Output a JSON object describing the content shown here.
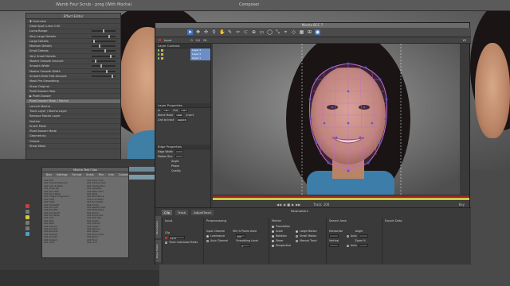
{
  "topbar": {
    "title": "Composer",
    "sequence": "Wamb Four Scrub - prog (With Mocha)"
  },
  "effect_editor": {
    "title": "Effect Editor",
    "rows": [
      "▼ Overview",
      "Glow  Spot Luma  0.00",
      "Luma Range",
      "Very Large Details",
      "Large Details",
      "Medium Details",
      "Small Details",
      "Very Small Details",
      "Master Smooth Amount",
      "Smooth Width",
      "Master Smooth Width",
      "Smooth Rate Edit Amount",
      "Mask Pre-Smoothing",
      "Show Original",
      "PixelChooser Help",
      "▶ PixelChooser",
      "PixelChooser Mask / Mocha",
      "Launch Mocha",
      "Track Layer / Mocha Layer",
      "Remove Mocha Layer",
      "Feather",
      "Invert Mask",
      "PixelChooser Mode",
      "Geometrics",
      "Output",
      "Show Mask"
    ]
  },
  "bin": {
    "title": "Mocha Test Clips",
    "tabs": [
      "Bins",
      "Settings",
      "Format",
      "Script",
      "Film",
      "Info",
      "Custom"
    ],
    "left_clips": [
      "A01 Skin",
      "A01 Frame Enhanced",
      "A01 Cam & Wide",
      "A01 Close Up",
      "A01 Face Mid",
      "A01 Face Wide",
      "A01 Fridge Foreground",
      "A01 Flare",
      "A01 Flash",
      "A01 Highlight",
      "A01 Kris Left",
      "A01 Kris Mid",
      "A01 Kris Right",
      "A01 Kris Wide",
      "A01 Low",
      "A01 Med",
      "A01 Nikki",
      "A01 Overall",
      "A01 Ponytail",
      "A01 Remove",
      "A01 Shadow",
      "A01 Smooth",
      "A01 Subject",
      "A01 Track"
    ],
    "right_clips": [
      "A01 Track Solo",
      "A01 Tracker Hold",
      "A01 Tracker Blur",
      "A01 Vignette",
      "A01 Warp Cam",
      "A01 Wide",
      "A01 Face Ramp",
      "A01 Eye Detail",
      "A01 Ear Detail",
      "A01 Fringe",
      "A01 Weight Shot",
      "A01 Wide Move",
      "A01 Zoom",
      "A01 Zoom Out",
      "A01 Skin Mix",
      "A01 Grade",
      "A01 Outline",
      "A01 Lower",
      "A01 Moving",
      "A01 Upper",
      "A01 Zoom Hold",
      "A01 Recut",
      "A01 Final",
      "A01 Sync"
    ]
  },
  "mocha": {
    "window_title": "Mocha BCC 7",
    "toolbar2": {
      "input_label": "Input",
      "frame": "0",
      "fps": "0.0",
      "view": "Fit",
      "right_label": "YE"
    },
    "layer_controls": {
      "title": "Layer Controls",
      "layers": [
        "Layer 3",
        "Layer 2",
        "Layer 1"
      ]
    },
    "layer_properties": {
      "title": "Layer Properties",
      "in_label": "In",
      "in_value": "0",
      "out_label": "Out",
      "out_value": "0",
      "blend_mode_label": "Blend Mode",
      "blend_mode_value": "Add",
      "invert_label": "Invert",
      "link_label": "Link to track",
      "link_value": "Layer 1"
    },
    "edge_properties": {
      "title": "Edge Properties",
      "edge_width_label": "Edge Width",
      "motion_blur_label": "Motion Blur",
      "angle_label": "Angle",
      "phase_label": "Phase",
      "quality_label": "Quality"
    },
    "transport": {
      "label": "Track",
      "key_label": "Key",
      "frame": "100"
    },
    "parameters_title": "Parameters",
    "tabs": [
      "Clip",
      "Track",
      "AdjustTrack"
    ],
    "side_tabs": [
      "Parameters",
      "Dope Sheet"
    ],
    "columns": {
      "input": {
        "title": "Input",
        "clip_label": "Clip",
        "clip_value": "Input",
        "track_individual": "Track Individual Fields"
      },
      "preprocessing": {
        "title": "Preprocessing",
        "input_channel": "Input Channel",
        "luminance": "Luminance",
        "auto_channel": "Auto Channel",
        "min_pixels_label": "Min % Pixels Used",
        "min_pixels_value": "300",
        "smoothing_label": "Smoothing Level",
        "smoothing_value": "0"
      },
      "motion": {
        "title": "Motion",
        "translation": "Translation",
        "scale": "Scale",
        "rotation": "Rotation",
        "shear": "Shear",
        "perspective": "Perspective",
        "large_motion": "Large Motion",
        "small_motion": "Small Motion",
        "manual_track": "Manual Track"
      },
      "search_area": {
        "title": "Search Area",
        "horizontal": "Horizontal",
        "vertical": "Vertical",
        "angle": "Angle",
        "zoom": "Zoom %",
        "auto": "Auto"
      },
      "export_data": {
        "title": "Export Data"
      }
    }
  },
  "colors": {
    "accent": "#3d73c4",
    "mask": "#c86ad0",
    "track_dot": "#4b5bd6",
    "timeline_red": "#9b2626"
  }
}
